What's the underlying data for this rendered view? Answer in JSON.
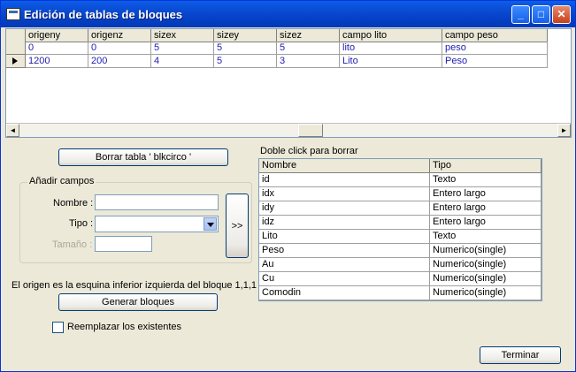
{
  "window": {
    "title": "Edición de tablas de bloques",
    "controls": {
      "minimize": "_",
      "maximize": "□",
      "close": "✕"
    }
  },
  "grid": {
    "columns": [
      "origeny",
      "origenz",
      "sizex",
      "sizey",
      "sizez",
      "campo lito",
      "campo peso"
    ],
    "rows": [
      [
        "0",
        "0",
        "5",
        "5",
        "5",
        "lito",
        "peso"
      ],
      [
        "1200",
        "200",
        "4",
        "5",
        "3",
        "Lito",
        "Peso"
      ]
    ],
    "selected_row": 1
  },
  "buttons": {
    "delete_table": "Borrar tabla ' blkcirco '",
    "add_field": ">>",
    "generate": "Generar bloques",
    "finish": "Terminar"
  },
  "add_fields": {
    "group_title": "Añadir campos",
    "name_label": "Nombre :",
    "name_value": "",
    "type_label": "Tipo :",
    "type_value": "",
    "size_label": "Tamaño :",
    "size_value": ""
  },
  "fields_list": {
    "hint": "Doble click para borrar",
    "columns": [
      "Nombre",
      "Tipo"
    ],
    "rows": [
      [
        "id",
        "Texto"
      ],
      [
        "idx",
        "Entero largo"
      ],
      [
        "idy",
        "Entero largo"
      ],
      [
        "idz",
        "Entero largo"
      ],
      [
        "Lito",
        "Texto"
      ],
      [
        "Peso",
        "Numerico(single)"
      ],
      [
        "Au",
        "Numerico(single)"
      ],
      [
        "Cu",
        "Numerico(single)"
      ],
      [
        "Comodin",
        "Numerico(single)"
      ]
    ]
  },
  "origin_note": "El origen es la esquina inferior izquierda del bloque 1,1,1",
  "replace_checkbox": {
    "label": "Reemplazar los existentes",
    "checked": false
  },
  "colors": {
    "titlebar": "#0A5FEA",
    "window_bg": "#ECE9D8",
    "grid_text": "#1D1DB0"
  }
}
